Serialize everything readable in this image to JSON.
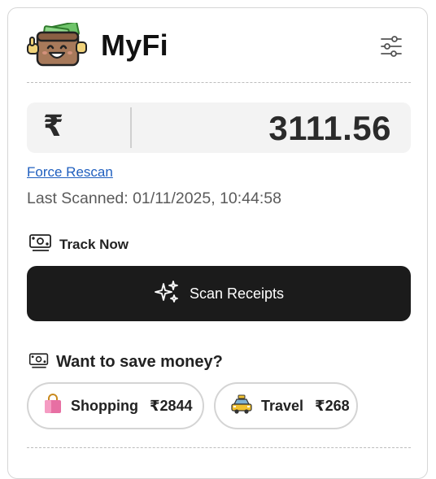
{
  "app": {
    "title": "MyFi",
    "logo_icon": "wallet-mascot-icon",
    "settings_icon": "sliders-icon"
  },
  "balance": {
    "currency_symbol": "₹",
    "amount": "3111.56"
  },
  "scan": {
    "force_rescan_label": "Force Rescan",
    "last_scanned": "Last Scanned: 01/11/2025, 10:44:58"
  },
  "track": {
    "heading": "Track Now",
    "heading_icon": "cash-icon",
    "scan_button_label": "Scan Receipts",
    "scan_button_icon": "sparkles-icon"
  },
  "savings": {
    "heading": "Want to save money?",
    "heading_icon": "cash-icon",
    "categories": [
      {
        "label": "Shopping",
        "amount": "₹2844",
        "icon": "shopping-bag-icon"
      },
      {
        "label": "Travel",
        "amount": "₹268",
        "icon": "taxi-icon"
      }
    ]
  },
  "colors": {
    "accent_dark": "#1b1b1b",
    "link": "#1f5fbf",
    "amount_bg": "#f3f3f3"
  }
}
